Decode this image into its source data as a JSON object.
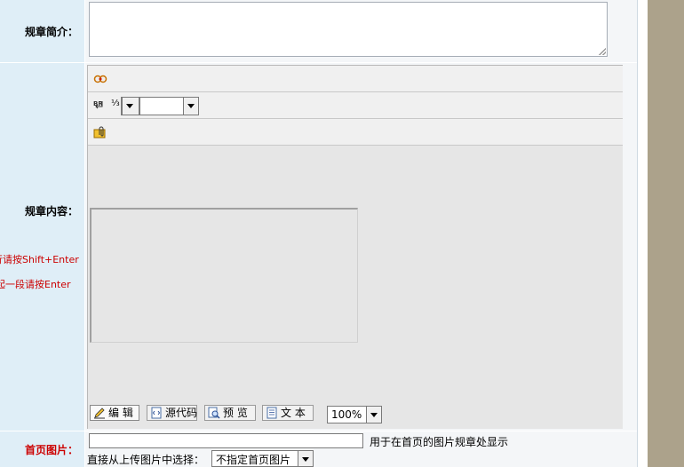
{
  "fields": {
    "summary_label": "规章简介：",
    "content_label": "规章内容：",
    "hint_line1": "行请按Shift+Enter",
    "hint_line2": "另起一段请按Enter",
    "image_label": "首页图片：",
    "image_hint": "用于在首页的图片规章处显示",
    "select_from_uploaded_label": "直接从上传图片中选择：",
    "select_from_uploaded_value": "不指定首页图片"
  },
  "editor": {
    "toolbar_rows": [
      {
        "icon": "toolbar-special-icon"
      },
      {
        "icon": "line-break-icon"
      },
      {
        "icon": "attachment-icon"
      }
    ],
    "modes": [
      {
        "label": "编 辑",
        "icon": "edit-pencil-icon",
        "active": true
      },
      {
        "label": "源代码",
        "icon": "source-code-icon",
        "active": false
      },
      {
        "label": "预 览",
        "icon": "preview-icon",
        "active": false
      },
      {
        "label": "文 本",
        "icon": "text-document-icon",
        "active": false
      }
    ],
    "zoom": "100%",
    "fraction_glyph": "⅓"
  },
  "colors": {
    "label_bg": "#dfeef7",
    "accent_red": "#cc0000",
    "right_band": "#aca28b"
  }
}
